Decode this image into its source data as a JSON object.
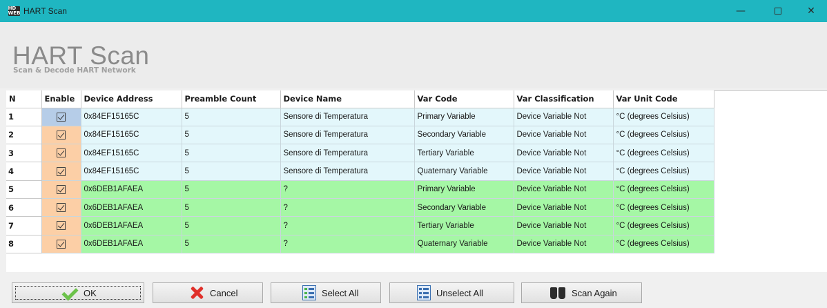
{
  "window": {
    "app_icon_text": "HD WEB",
    "title": "HART Scan",
    "minimize_glyph": "—",
    "close_glyph": "✕"
  },
  "header": {
    "title": "HART Scan",
    "subtitle": "Scan & Decode HART Network"
  },
  "grid": {
    "columns": [
      "N",
      "Enable",
      "Device Address",
      "Preamble Count",
      "Device Name",
      "Var Code",
      "Var Classification",
      "Var Unit Code"
    ],
    "rows": [
      {
        "n": "1",
        "enabled": true,
        "address": "0x84EF15165C",
        "preamble": "5",
        "name": "Sensore di Temperatura",
        "var_code": "Primary Variable",
        "classification": "Device Variable Not",
        "unit": "°C (degrees Celsius)"
      },
      {
        "n": "2",
        "enabled": true,
        "address": "0x84EF15165C",
        "preamble": "5",
        "name": "Sensore di Temperatura",
        "var_code": "Secondary Variable",
        "classification": "Device Variable Not",
        "unit": "°C (degrees Celsius)"
      },
      {
        "n": "3",
        "enabled": true,
        "address": "0x84EF15165C",
        "preamble": "5",
        "name": "Sensore di Temperatura",
        "var_code": "Tertiary Variable",
        "classification": "Device Variable Not",
        "unit": "°C (degrees Celsius)"
      },
      {
        "n": "4",
        "enabled": true,
        "address": "0x84EF15165C",
        "preamble": "5",
        "name": "Sensore di Temperatura",
        "var_code": "Quaternary Variable",
        "classification": "Device Variable Not",
        "unit": "°C (degrees Celsius)"
      },
      {
        "n": "5",
        "enabled": true,
        "address": "0x6DEB1AFAEA",
        "preamble": "5",
        "name": "?",
        "var_code": "Primary Variable",
        "classification": "Device Variable Not",
        "unit": "°C (degrees Celsius)"
      },
      {
        "n": "6",
        "enabled": true,
        "address": "0x6DEB1AFAEA",
        "preamble": "5",
        "name": "?",
        "var_code": "Secondary Variable",
        "classification": "Device Variable Not",
        "unit": "°C (degrees Celsius)"
      },
      {
        "n": "7",
        "enabled": true,
        "address": "0x6DEB1AFAEA",
        "preamble": "5",
        "name": "?",
        "var_code": "Tertiary Variable",
        "classification": "Device Variable Not",
        "unit": "°C (degrees Celsius)"
      },
      {
        "n": "8",
        "enabled": true,
        "address": "0x6DEB1AFAEA",
        "preamble": "5",
        "name": "?",
        "var_code": "Quaternary Variable",
        "classification": "Device Variable Not",
        "unit": "°C (degrees Celsius)"
      }
    ],
    "colors": {
      "row_known_device": "#e3f7fb",
      "row_unknown_device": "#a5f7a5",
      "enable_cell": "#fccfa6",
      "enable_cell_selected": "#b6cde8"
    }
  },
  "buttons": {
    "ok": "OK",
    "cancel": "Cancel",
    "select_all": "Select All",
    "unselect_all": "Unselect All",
    "scan_again": "Scan Again"
  },
  "icons": {
    "ok": "checkmark-icon",
    "cancel": "red-x-icon",
    "select_all": "checklist-icon",
    "unselect_all": "list-icon",
    "scan_again": "binoculars-icon"
  },
  "theme": {
    "titlebar": "#1fb6c1"
  }
}
